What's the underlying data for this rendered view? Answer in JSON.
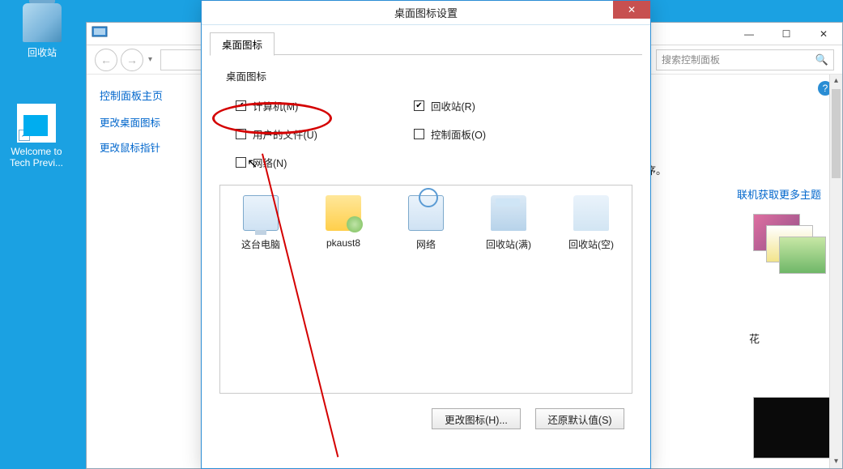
{
  "desktop": {
    "recycle_label": "回收站",
    "welcome_label": "Welcome to Tech Previ..."
  },
  "bg_window": {
    "search_placeholder": "搜索控制面板",
    "sidebar": {
      "home": "控制面板主页",
      "links": [
        "更改桌面图标",
        "更改鼠标指针"
      ]
    },
    "heading_suffix": "序。",
    "theme_link": "联机获取更多主题",
    "flower_label": "花"
  },
  "dialog": {
    "title": "桌面图标设置",
    "tab": "桌面图标",
    "group_title": "桌面图标",
    "checks": {
      "computer": "计算机(M)",
      "recycle": "回收站(R)",
      "userfiles": "用户的文件(U)",
      "cpl": "控制面板(O)",
      "network": "网络(N)"
    },
    "icons": {
      "pc": "这台电脑",
      "user": "pkaust8",
      "net": "网络",
      "bin_full": "回收站(满)",
      "bin_empty": "回收站(空)"
    },
    "buttons": {
      "change_icon": "更改图标(H)...",
      "restore": "还原默认值(S)"
    }
  }
}
